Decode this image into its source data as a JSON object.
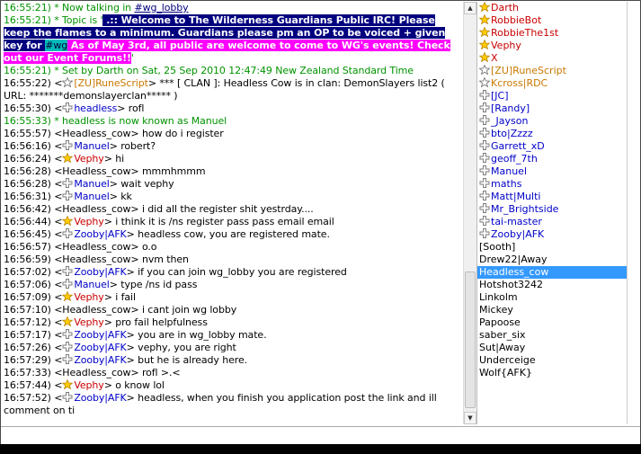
{
  "colors": {
    "timestamp": "#000000",
    "event": "#009300",
    "nick_voice": "#0000c8",
    "nick_op": "#c80000",
    "nick_halfop": "#c87800",
    "selected": "#3399ff"
  },
  "chat": {
    "lines": [
      {
        "ts": "16:55:21)",
        "text": " * Now talking in ",
        "link": "#wg_lobby",
        "kind": "event"
      },
      {
        "ts": "16:55:21)",
        "kind": "topic"
      },
      {
        "ts": "16:55:21)",
        "text": " * Set by Darth on Sat, 25 Sep 2010 12:47:49 New Zealand Standard Time",
        "kind": "event"
      },
      {
        "ts": "16:55:22)",
        "text": " <",
        "icon": "star-outline",
        "nick": "[ZU]RuneScript",
        "msg": "> *** [ CLAN ]: Headless Cow is in clan: DemonSlayers list2 ( URL: *******demonslayerclan***** )",
        "kind": "clan"
      },
      {
        "ts": "16:55:30)",
        "text": " <",
        "icon": "voice",
        "nick": "headless",
        "msg": "> rofl",
        "kind": "msg"
      },
      {
        "ts": "16:55:33)",
        "text": " * headless is now known as Manuel",
        "kind": "event"
      },
      {
        "ts": "16:55:57)",
        "text": " <Headless_cow> how do i register",
        "kind": "plain"
      },
      {
        "ts": "16:56:16)",
        "text": " <",
        "icon": "voice",
        "nick": "Manuel",
        "msg": "> robert?",
        "kind": "msg"
      },
      {
        "ts": "16:56:24)",
        "text": " <",
        "icon": "star",
        "nick": "Vephy",
        "msg": "> hi",
        "kind": "msgop"
      },
      {
        "ts": "16:56:28)",
        "text": " <Headless_cow> mmmhmmm",
        "kind": "plain"
      },
      {
        "ts": "16:56:28)",
        "text": " <",
        "icon": "voice",
        "nick": "Manuel",
        "msg": "> wait vephy",
        "kind": "msg"
      },
      {
        "ts": "16:56:31)",
        "text": " <",
        "icon": "voice",
        "nick": "Manuel",
        "msg": "> kk",
        "kind": "msg"
      },
      {
        "ts": "16:56:42)",
        "text": " <Headless_cow> i did all the register shit yestrday....",
        "kind": "plain"
      },
      {
        "ts": "16:56:44)",
        "text": " <",
        "icon": "star",
        "nick": "Vephy",
        "msg": "> i think it is /ns register pass pass email email",
        "kind": "msgop"
      },
      {
        "ts": "16:56:45)",
        "text": " <",
        "icon": "voice",
        "nick": "Zooby|AFK",
        "msg": "> headless cow, you are registered mate.",
        "kind": "msg"
      },
      {
        "ts": "16:56:57)",
        "text": " <Headless_cow> o.o",
        "kind": "plain"
      },
      {
        "ts": "16:56:59)",
        "text": " <Headless_cow> nvm then",
        "kind": "plain"
      },
      {
        "ts": "16:57:02)",
        "text": " <",
        "icon": "voice",
        "nick": "Zooby|AFK",
        "msg": "> if you can join wg_lobby you are registered",
        "kind": "msg"
      },
      {
        "ts": "16:57:06)",
        "text": " <",
        "icon": "voice",
        "nick": "Manuel",
        "msg": "> type /ns id pass",
        "kind": "msg"
      },
      {
        "ts": "16:57:09)",
        "text": " <",
        "icon": "star",
        "nick": "Vephy",
        "msg": "> i fail",
        "kind": "msgop"
      },
      {
        "ts": "16:57:10)",
        "text": " <Headless_cow> i cant join wg lobby",
        "kind": "plain"
      },
      {
        "ts": "16:57:12)",
        "text": " <",
        "icon": "star",
        "nick": "Vephy",
        "msg": "> pro fail helpfulness",
        "kind": "msgop"
      },
      {
        "ts": "16:57:17)",
        "text": " <",
        "icon": "voice",
        "nick": "Zooby|AFK",
        "msg": "> you are in wg_lobby mate.",
        "kind": "msg"
      },
      {
        "ts": "16:57:26)",
        "text": " <",
        "icon": "voice",
        "nick": "Zooby|AFK",
        "msg": "> vephy, you are right",
        "kind": "msg"
      },
      {
        "ts": "16:57:29)",
        "text": " <",
        "icon": "voice",
        "nick": "Zooby|AFK",
        "msg": "> but he is already here.",
        "kind": "msg"
      },
      {
        "ts": "16:57:33)",
        "text": " <Headless_cow> rofl >.<",
        "kind": "plain"
      },
      {
        "ts": "16:57:44)",
        "text": " <",
        "icon": "star",
        "nick": "Vephy",
        "msg": "> o know lol",
        "kind": "msgop"
      },
      {
        "ts": "16:57:52)",
        "text": " <",
        "icon": "voice",
        "nick": "Zooby|AFK",
        "msg": "> headless, when you finish you application post the link and ill comment on ti",
        "kind": "msg"
      }
    ],
    "topic": {
      "prefix": " * Topic is '",
      "part1": " .:: Welcome to The Wilderness Guardians Public IRC! Please keep the flames to a minimum. Guardians please pm an OP to be voiced + given key for ",
      "channel": "#wg",
      "part2": " As of May 3rd, all public are welcome to come to WG's events! Check out our Event Forums!!",
      "suffix": "'"
    }
  },
  "nicklist": [
    {
      "name": "Darth",
      "icon": "star",
      "color": "#c80000"
    },
    {
      "name": "RobbieBot",
      "icon": "star",
      "color": "#c80000"
    },
    {
      "name": "RobbieThe1st",
      "icon": "star",
      "color": "#c80000"
    },
    {
      "name": "Vephy",
      "icon": "star",
      "color": "#c80000"
    },
    {
      "name": "X",
      "icon": "star",
      "color": "#c80000"
    },
    {
      "name": "[ZU]RuneScript",
      "icon": "star-outline",
      "color": "#c87800"
    },
    {
      "name": "Kcross|RDC",
      "icon": "star-outline",
      "color": "#c87800"
    },
    {
      "name": "[JC]",
      "icon": "voice",
      "color": "#0000c8"
    },
    {
      "name": "[Randy]",
      "icon": "voice",
      "color": "#0000c8"
    },
    {
      "name": "_Jayson",
      "icon": "voice",
      "color": "#0000c8"
    },
    {
      "name": "bto|Zzzz",
      "icon": "voice",
      "color": "#0000c8"
    },
    {
      "name": "Garrett_xD",
      "icon": "voice",
      "color": "#0000c8"
    },
    {
      "name": "geoff_7th",
      "icon": "voice",
      "color": "#0000c8"
    },
    {
      "name": "Manuel",
      "icon": "voice",
      "color": "#0000c8"
    },
    {
      "name": "maths",
      "icon": "voice",
      "color": "#0000c8"
    },
    {
      "name": "Matt|Multi",
      "icon": "voice",
      "color": "#0000c8"
    },
    {
      "name": "Mr_Brightside",
      "icon": "voice",
      "color": "#0000c8"
    },
    {
      "name": "tai-master",
      "icon": "voice",
      "color": "#0000c8"
    },
    {
      "name": "Zooby|AFK",
      "icon": "voice",
      "color": "#0000c8"
    },
    {
      "name": "[Sooth]",
      "icon": "none",
      "color": "#000000"
    },
    {
      "name": "Drew22|Away",
      "icon": "none",
      "color": "#000000"
    },
    {
      "name": "Headless_cow",
      "icon": "none",
      "color": "#ffffff",
      "selected": true
    },
    {
      "name": "Hotshot3242",
      "icon": "none",
      "color": "#000000"
    },
    {
      "name": "Linkolm",
      "icon": "none",
      "color": "#000000"
    },
    {
      "name": "Mickey",
      "icon": "none",
      "color": "#000000"
    },
    {
      "name": "Papoose",
      "icon": "none",
      "color": "#000000"
    },
    {
      "name": "saber_six",
      "icon": "none",
      "color": "#000000"
    },
    {
      "name": "Sut|Away",
      "icon": "none",
      "color": "#000000"
    },
    {
      "name": "Underceige",
      "icon": "none",
      "color": "#000000"
    },
    {
      "name": "Wolf{AFK}",
      "icon": "none",
      "color": "#000000"
    }
  ],
  "input": {
    "value": ""
  }
}
